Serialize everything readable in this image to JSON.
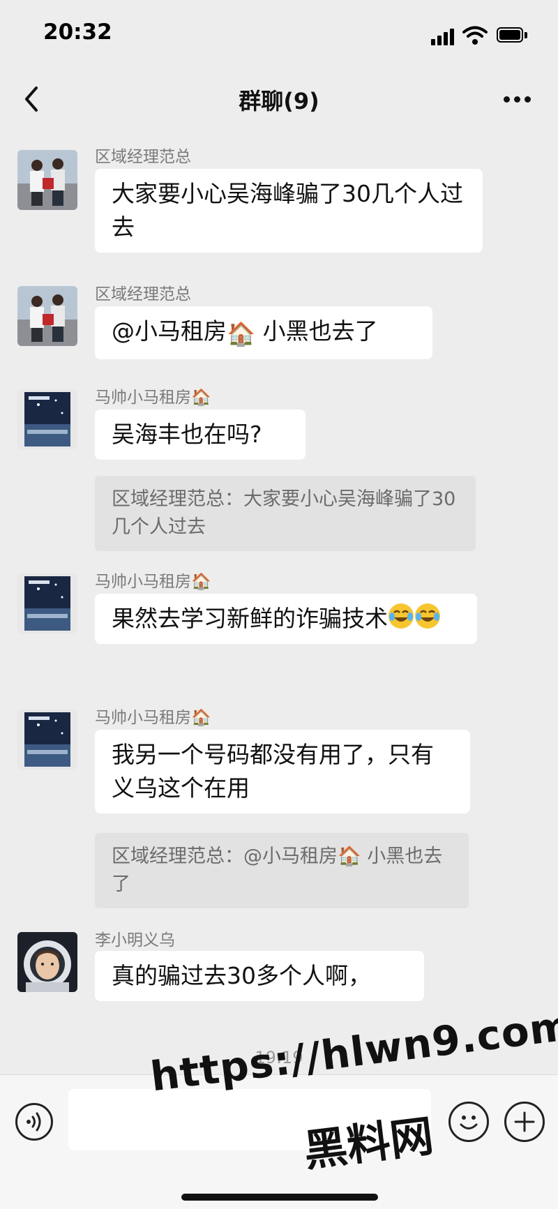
{
  "status_bar": {
    "time": "20:32"
  },
  "header": {
    "title": "群聊(9)"
  },
  "messages": [
    {
      "sender": "区域经理范总",
      "text": "大家要小心吴海峰骗了30几个人过去"
    },
    {
      "sender": "区域经理范总",
      "text_before": "@小马租房",
      "house_emoji": "🏠",
      "text_after": " 小黑也去了"
    },
    {
      "sender": "马帅小马租房",
      "sender_emoji": "🏠",
      "text": "吴海丰也在吗?",
      "quote": "区域经理范总：大家要小心吴海峰骗了30几个人过去"
    },
    {
      "sender": "马帅小马租房",
      "sender_emoji": "🏠",
      "text": "果然去学习新鲜的诈骗技术"
    },
    {
      "sender": "马帅小马租房",
      "sender_emoji": "🏠",
      "text": "我另一个号码都没有用了，只有义乌这个在用",
      "quote_before": "区域经理范总：@小马租房",
      "quote_emoji": "🏠",
      "quote_after": " 小黑也去了"
    },
    {
      "sender": "李小明义乌",
      "text": "真的骗过去30多个人啊，"
    }
  ],
  "time_divider": "19:19",
  "input": {
    "placeholder": ""
  },
  "watermark": {
    "url": "https://hlwn9.com",
    "name": "黑料网"
  },
  "colors": {
    "background": "#ededed",
    "bubble": "#ffffff",
    "quote": "#e2e2e2",
    "sender": "#7a7a7a"
  }
}
